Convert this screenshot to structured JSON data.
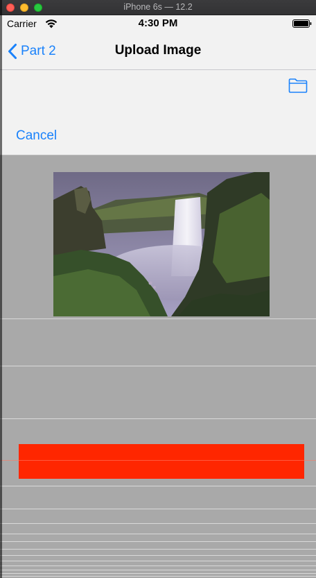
{
  "window": {
    "title": "iPhone 6s — 12.2"
  },
  "status_bar": {
    "carrier": "Carrier",
    "time": "4:30 PM",
    "icons": [
      "wifi-icon",
      "battery-icon"
    ]
  },
  "nav": {
    "back_label": "Part 2",
    "title": "Upload Image",
    "icons": [
      "chevron-left-icon"
    ]
  },
  "toolbar": {
    "folder_icon": "folder-icon",
    "cancel_label": "Cancel"
  },
  "content": {
    "image": {
      "subject": "waterfall-photo"
    },
    "action_bar_color": "#FF2600"
  },
  "colors": {
    "accent": "#1A82FB",
    "bar_background": "#F2F2F2",
    "content_background": "#A9A9A9",
    "action_red": "#FF2600"
  }
}
